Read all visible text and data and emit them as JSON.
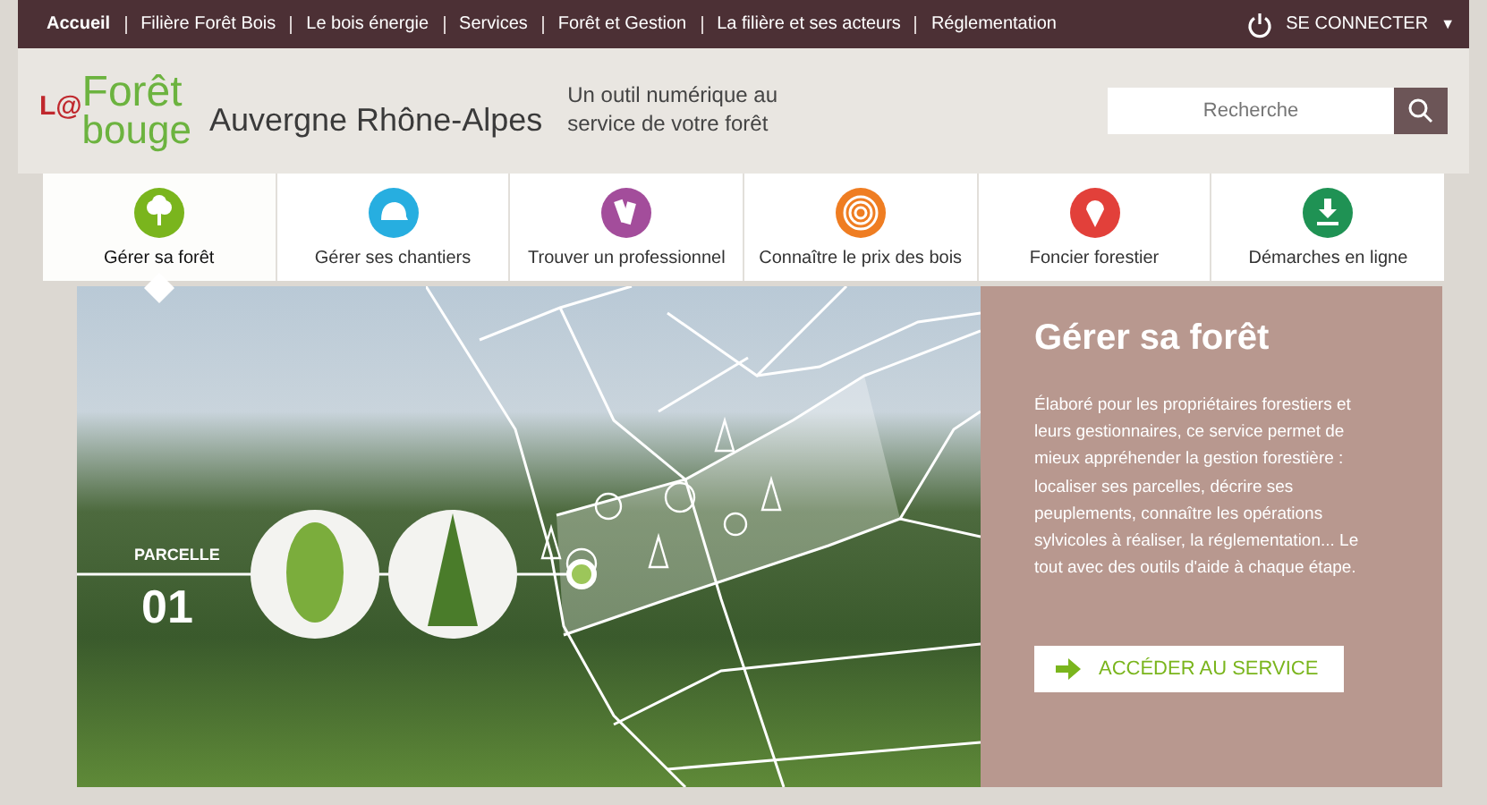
{
  "top_nav": {
    "links": [
      {
        "label": "Accueil",
        "selected": true
      },
      {
        "label": "Filière Forêt Bois",
        "selected": false
      },
      {
        "label": "Le bois énergie",
        "selected": false
      },
      {
        "label": "Services",
        "selected": false
      },
      {
        "label": "Forêt et Gestion",
        "selected": false
      },
      {
        "label": "La filière et ses acteurs",
        "selected": false
      },
      {
        "label": "Réglementation",
        "selected": false
      }
    ],
    "login": "SE CONNECTER",
    "login_caret": "▼"
  },
  "header": {
    "logo_top": "Forêt",
    "logo_prefix": "L@",
    "logo_bottom": "bouge",
    "region": "Auvergne Rhône-Alpes",
    "tagline": "Un outil numérique au service de votre forêt",
    "search": {
      "placeholder": "Recherche"
    }
  },
  "services": [
    {
      "label": "Gérer sa forêt",
      "color": "#7ab51d",
      "kind": "tree",
      "selected": true
    },
    {
      "label": "Gérer ses chantiers",
      "color": "#27aee0",
      "kind": "helmet",
      "selected": false
    },
    {
      "label": "Trouver un professionnel",
      "color": "#a34d9b",
      "kind": "cards",
      "selected": false
    },
    {
      "label": "Connaître le prix des bois",
      "color": "#ef7d22",
      "kind": "rings",
      "selected": false
    },
    {
      "label": "Foncier forestier",
      "color": "#e2403a",
      "kind": "pin",
      "selected": false
    },
    {
      "label": "Démarches en ligne",
      "color": "#1f9254",
      "kind": "download",
      "selected": false
    }
  ],
  "hero": {
    "parcel_label": "PARCELLE",
    "parcel_number": "01",
    "title": "Gérer sa forêt",
    "description": "Élaboré pour les propriétaires forestiers et leurs gestionnaires, ce service permet de mieux appréhender la gestion forestière : localiser ses parcelles, décrire ses peuplements, connaître les opérations sylvicoles à réaliser, la réglementation... Le tout avec des outils d'aide à chaque étape.",
    "cta": "ACCÉDER AU SERVICE"
  }
}
